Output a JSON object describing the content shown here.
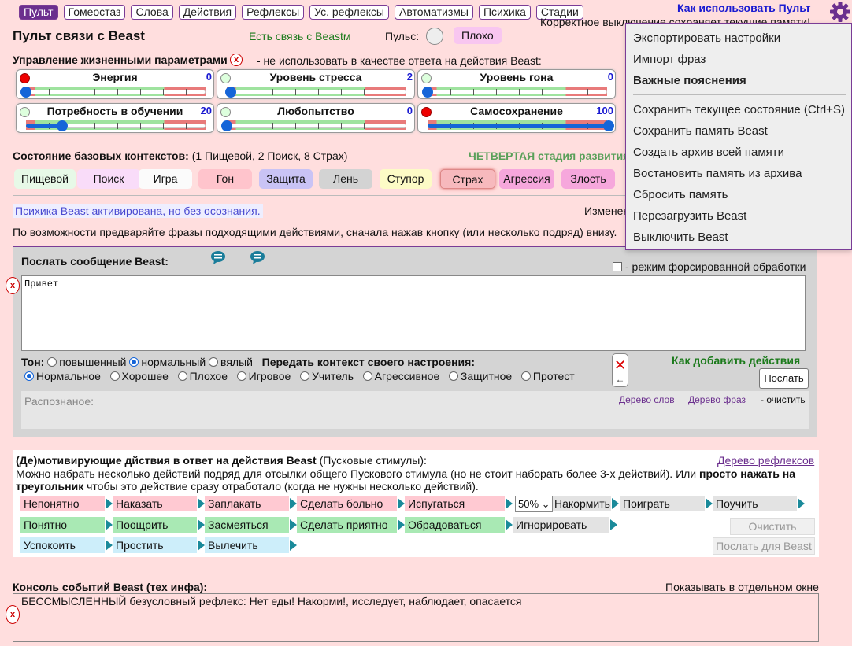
{
  "nav": {
    "tabs": [
      "Пульт",
      "Гомеостаз",
      "Слова",
      "Действия",
      "Рефлексы",
      "Ус. рефлексы",
      "Автоматизмы",
      "Психика",
      "Стадии"
    ],
    "howto": "Как использовать Пульт",
    "note": "Корректное выключение сохраняет текущие памяти!"
  },
  "header": {
    "title": "Пульт связи с Beast",
    "connection": "Есть связь с Beastм",
    "pulse_label": "Пульс:",
    "status": "Плохо"
  },
  "params": {
    "title": "Управление жизненными параметрами",
    "note": "- не использовать в качестве ответа на действия Beast:",
    "items": [
      {
        "name": "Энергия",
        "value": "0",
        "level": 0,
        "alarm": true
      },
      {
        "name": "Уровень стресса",
        "value": "2",
        "level": 0.02,
        "alarm": false
      },
      {
        "name": "Уровень гона",
        "value": "0",
        "level": 0,
        "alarm": false
      },
      {
        "name": "Потребность в обучении",
        "value": "20",
        "level": 0.2,
        "alarm": false
      },
      {
        "name": "Любопытство",
        "value": "0",
        "level": 0,
        "alarm": false
      },
      {
        "name": "Самосохранение",
        "value": "100",
        "level": 1,
        "alarm": true
      }
    ]
  },
  "contexts": {
    "label": "Состояние базовых контекстов:",
    "label_detail": "(1 Пищевой, 2 Поиск, 8 Страх)",
    "stage": "ЧЕТВЕРТАЯ стадия развития",
    "items": [
      {
        "label": "Пищевой",
        "color": "#e7f9e7"
      },
      {
        "label": "Поиск",
        "color": "#f9dcf9"
      },
      {
        "label": "Игра",
        "color": "#fbfbfb"
      },
      {
        "label": "Гон",
        "color": "#ffc4cc"
      },
      {
        "label": "Защита",
        "color": "#c9c3f5"
      },
      {
        "label": "Лень",
        "color": "#d3d3d3"
      },
      {
        "label": "Ступор",
        "color": "#fdfbc6"
      },
      {
        "label": "Страх",
        "color": "#f7b9bd"
      },
      {
        "label": "Агрессия",
        "color": "#f6a7dc"
      },
      {
        "label": "Злость",
        "color": "#f6a7dc"
      }
    ]
  },
  "psyche": "Психика Beast активирована, но без осознания.",
  "changed": "Изменен",
  "hint": "По возможности предваряйте фразы подходящими действиями, сначала нажав кнопку (или несколько подряд) внизу.",
  "message": {
    "label": "Послать сообщение Beast",
    "force": "- режим форсированной обработки",
    "text": "Привет",
    "tone_label": "Тон:",
    "tones": [
      "повышенный",
      "нормальный",
      "вялый"
    ],
    "tone_selected": 1,
    "mood_label": "Передать контекст своего настроения:",
    "moods": [
      "Нормальное",
      "Хорошее",
      "Плохое",
      "Игровое",
      "Учитель",
      "Агрессивное",
      "Защитное",
      "Протест"
    ],
    "mood_selected": 0,
    "how_add": "Как добавить действия",
    "send": "Послать",
    "recognized": "Распознаное:",
    "words_tree": "Дерево слов",
    "phrase_tree": "Дерево фраз",
    "clear": "- очистить"
  },
  "motivation": {
    "title": "(Де)мотивирующие дйствия в ответ на действия Beast",
    "title_detail": "(Пусковые стимулы):",
    "reflex_tree": "Дерево рефлексов",
    "desc1": "Можно набрать несколько действий подряд для отсылки общего Пускового стимула (но не стоит наборать более 3-х действий). Или",
    "desc_bold": "просто нажать на треугольник",
    "desc2": "чтобы это действие сразу отработало (когда не нужны несколько действий).",
    "percent": "50%",
    "row1": [
      "Непонятно",
      "Наказать",
      "Заплакать",
      "Сделать больно",
      "Испугаться",
      "Накормить",
      "Поиграть",
      "Поучить"
    ],
    "row2": [
      "Понятно",
      "Поощрить",
      "Засмеяться",
      "Сделать приятно",
      "Обрадоваться",
      "Игнорировать"
    ],
    "row3": [
      "Успокоить",
      "Простить",
      "Вылечить"
    ],
    "clear": "Очистить",
    "send_beast": "Послать для Beast"
  },
  "console": {
    "label": "Консоль событий Beast (тех инфа):",
    "separate": "Показывать в отдельном окне",
    "text": "БЕССМЫСЛЕННЫЙ безусловный рефлекс: Нет еды! Накорми!, исследует, наблюдает, опасается"
  },
  "menu": {
    "items": [
      "Экспортировать настройки",
      "Импорт фраз",
      "Важные пояснения",
      "Сохранить текущее состояние (Ctrl+S)",
      "Сохранить память Beast",
      "Создать архив всей памяти",
      "Востановить память из архива",
      "Сбросить память",
      "Перезагрузить Beast",
      "Выключить Beast"
    ]
  }
}
